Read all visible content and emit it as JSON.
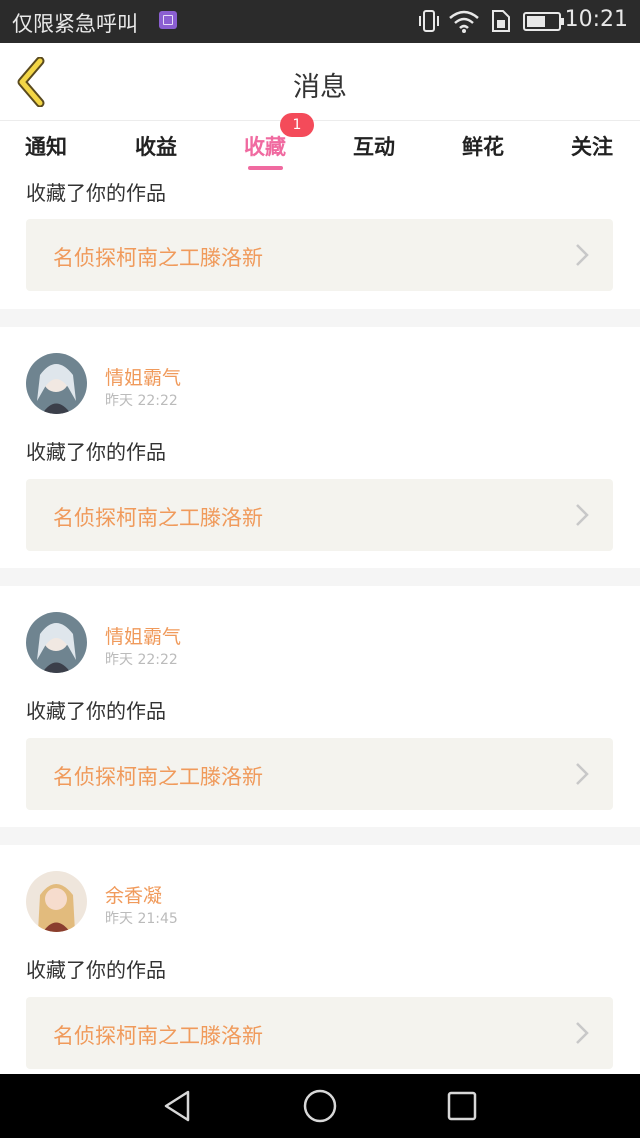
{
  "status_bar": {
    "carrier": "仅限紧急呼叫",
    "time": "10:21",
    "icons": [
      "gallery-notification-icon",
      "vibrate-icon",
      "wifi-icon",
      "sim-icon",
      "battery-icon"
    ]
  },
  "header": {
    "title": "消息",
    "back_icon": "chevron-left-icon"
  },
  "tabs": [
    {
      "label": "通知",
      "active": false
    },
    {
      "label": "收益",
      "active": false
    },
    {
      "label": "收藏",
      "active": true,
      "badge": "1"
    },
    {
      "label": "互动",
      "active": false
    },
    {
      "label": "鲜花",
      "active": false
    },
    {
      "label": "关注",
      "active": false
    }
  ],
  "colors": {
    "accent_pink": "#f06aa0",
    "username_orange": "#f09a5b",
    "badge_red": "#f44b5a"
  },
  "feed": [
    {
      "message": "收藏了你的作品",
      "work_title": "名侦探柯南之工滕洛新"
    },
    {
      "user": "情姐霸气",
      "time": "昨天 22:22",
      "message": "收藏了你的作品",
      "work_title": "名侦探柯南之工滕洛新"
    },
    {
      "user": "情姐霸气",
      "time": "昨天 22:22",
      "message": "收藏了你的作品",
      "work_title": "名侦探柯南之工滕洛新"
    },
    {
      "user": "余香凝",
      "time": "昨天 21:45",
      "message": "收藏了你的作品",
      "work_title": "名侦探柯南之工滕洛新"
    }
  ],
  "system_nav": [
    "back-triangle-icon",
    "home-circle-icon",
    "recents-square-icon"
  ]
}
